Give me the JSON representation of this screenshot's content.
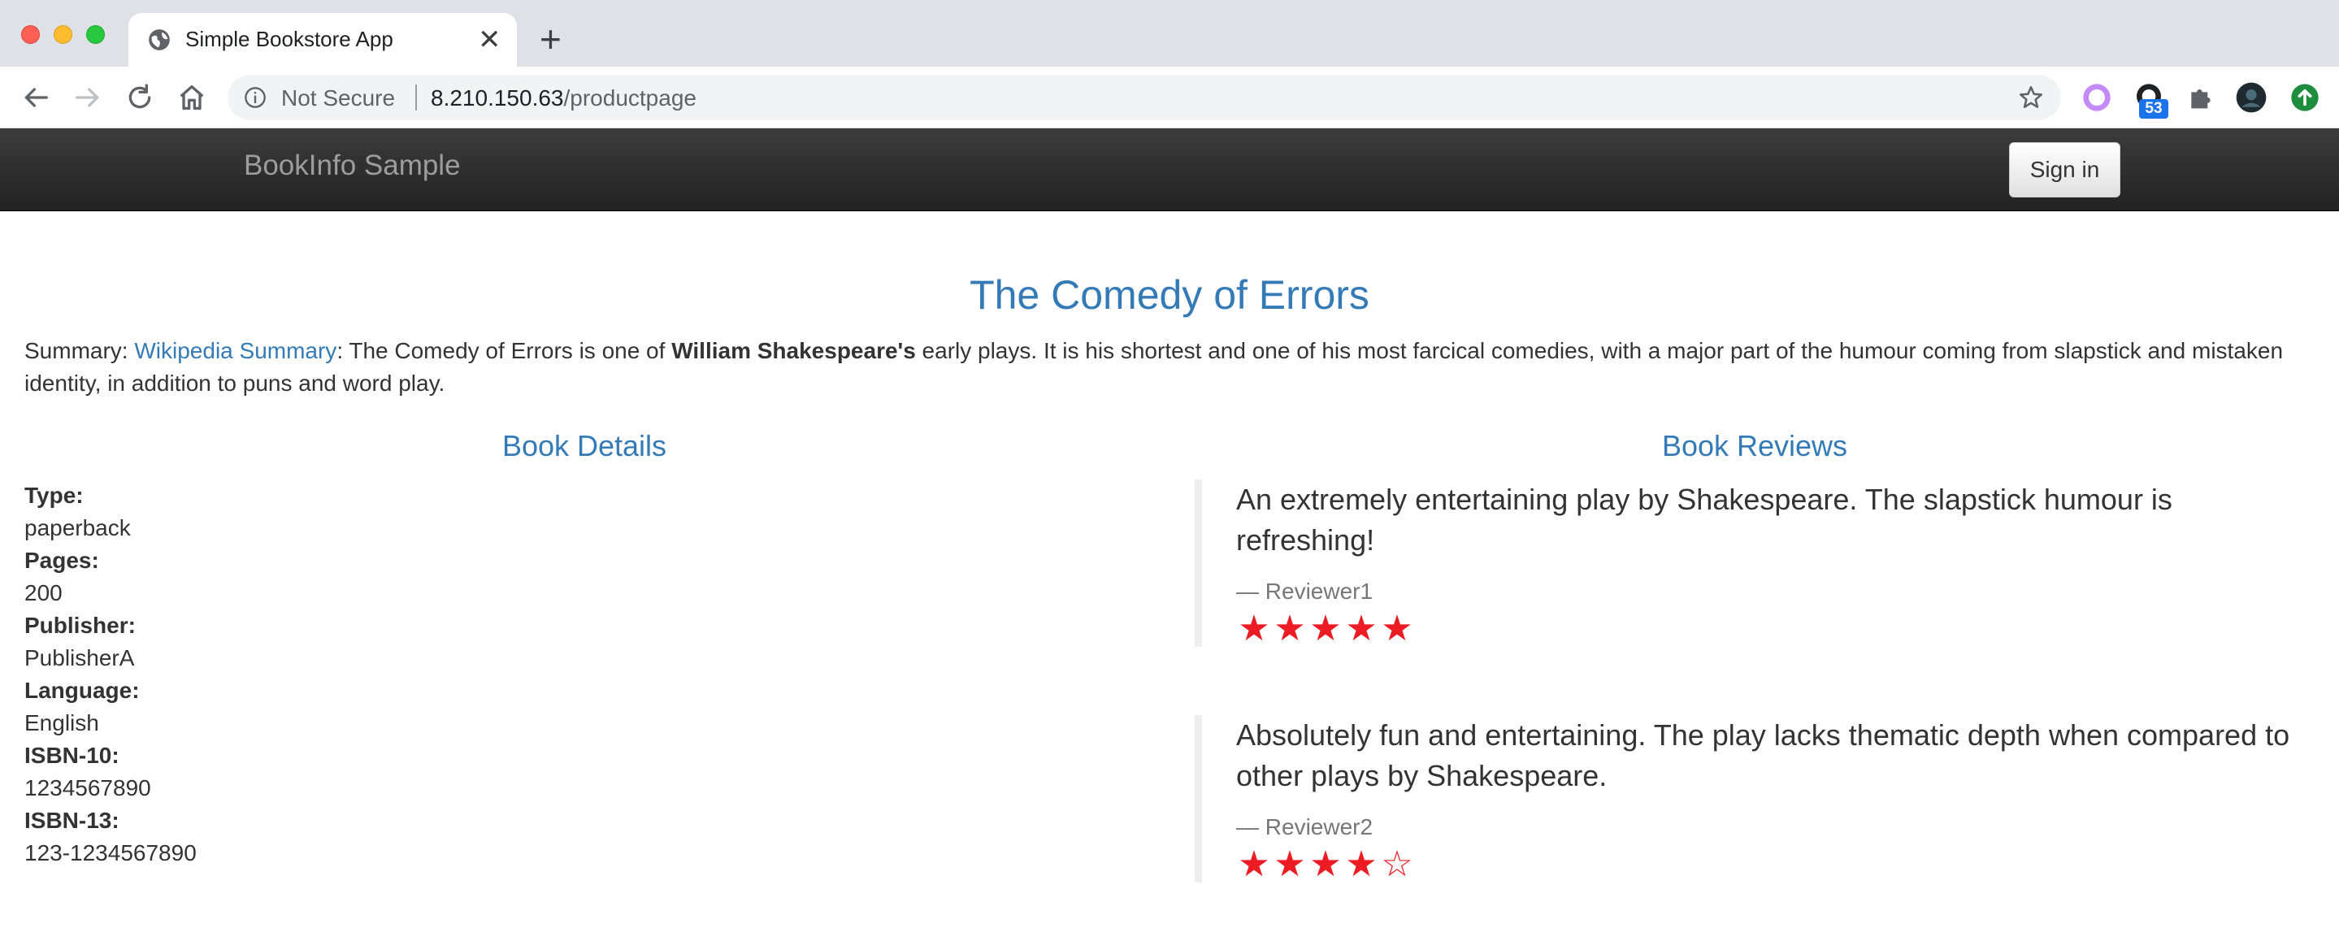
{
  "browser": {
    "tab_title": "Simple Bookstore App",
    "security_label": "Not Secure",
    "url_host": "8.210.150.63",
    "url_path": "/productpage",
    "extension_badge": "53"
  },
  "navbar": {
    "brand": "BookInfo Sample",
    "signin_label": "Sign in"
  },
  "book": {
    "title": "The Comedy of Errors",
    "summary_prefix": "Summary: ",
    "summary_link": "Wikipedia Summary",
    "summary_text_1": ": The Comedy of Errors is one of ",
    "summary_bold": "William Shakespeare's",
    "summary_text_2": " early plays. It is his shortest and one of his most farcical comedies, with a major part of the humour coming from slapstick and mistaken identity, in addition to puns and word play."
  },
  "details": {
    "heading": "Book Details",
    "items": [
      {
        "label": "Type:",
        "value": "paperback"
      },
      {
        "label": "Pages:",
        "value": "200"
      },
      {
        "label": "Publisher:",
        "value": "PublisherA"
      },
      {
        "label": "Language:",
        "value": "English"
      },
      {
        "label": "ISBN-10:",
        "value": "1234567890"
      },
      {
        "label": "ISBN-13:",
        "value": "123-1234567890"
      }
    ]
  },
  "reviews": {
    "heading": "Book Reviews",
    "items": [
      {
        "text": "An extremely entertaining play by Shakespeare. The slapstick humour is refreshing!",
        "reviewer": "— Reviewer1",
        "rating": 5,
        "max_rating": 5,
        "star_color": "#ed1c24"
      },
      {
        "text": "Absolutely fun and entertaining. The play lacks thematic depth when compared to other plays by Shakespeare.",
        "reviewer": "— Reviewer2",
        "rating": 4,
        "max_rating": 5,
        "star_color": "#ed1c24"
      }
    ]
  },
  "colors": {
    "heading_blue": "#337ab7",
    "navbar_dark": "#222222",
    "star_red": "#ed1c24"
  }
}
